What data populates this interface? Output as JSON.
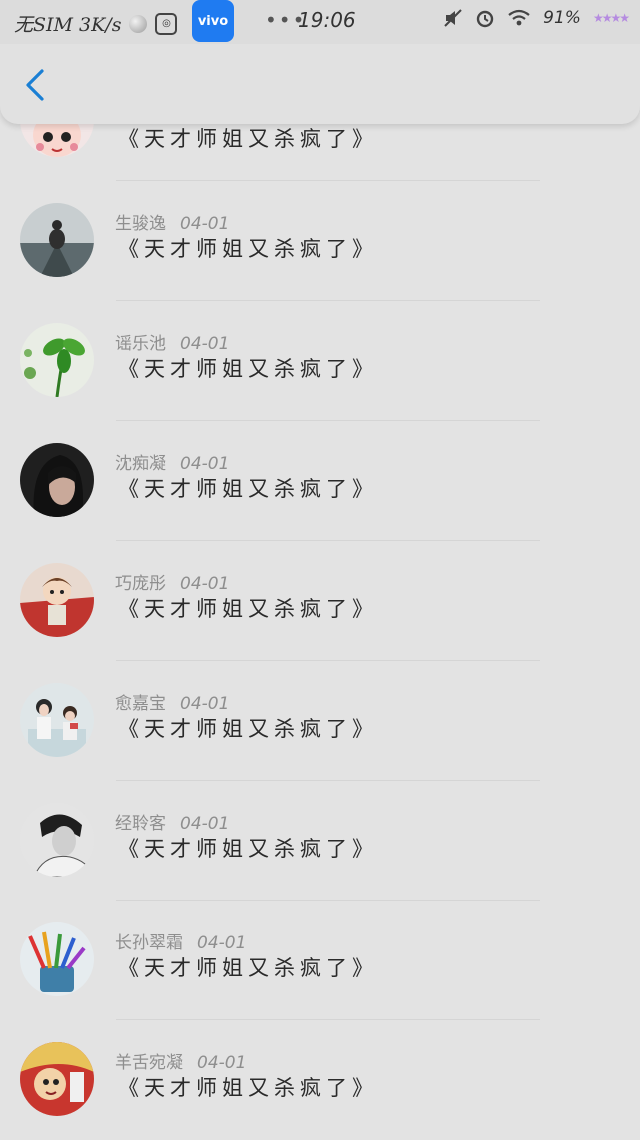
{
  "statusbar": {
    "carrier": "无SIM 3K/s",
    "vivo_badge": "vivo",
    "dots": "•••",
    "time": "19:06",
    "battery": "91%"
  },
  "nav": {
    "back_icon": "chevron-left-icon",
    "accent": "#1a7fd4"
  },
  "comments": [
    {
      "name": "",
      "date": "",
      "title": "《天才师姐又杀疯了》",
      "avatar_icon": "cartoon-girl-avatar"
    },
    {
      "name": "生骏逸",
      "date": "04-01",
      "title": "《天才师姐又杀疯了》",
      "avatar_icon": "boat-photo-avatar"
    },
    {
      "name": "谣乐池",
      "date": "04-01",
      "title": "《天才师姐又杀疯了》",
      "avatar_icon": "clover-photo-avatar"
    },
    {
      "name": "沈痴凝",
      "date": "04-01",
      "title": "《天才师姐又杀疯了》",
      "avatar_icon": "dark-portrait-avatar"
    },
    {
      "name": "巧庞彤",
      "date": "04-01",
      "title": "《天才师姐又杀疯了》",
      "avatar_icon": "cartoon-boy-avatar"
    },
    {
      "name": "愈嘉宝",
      "date": "04-01",
      "title": "《天才师姐又杀疯了》",
      "avatar_icon": "two-girls-avatar"
    },
    {
      "name": "经聆客",
      "date": "04-01",
      "title": "《天才师姐又杀疯了》",
      "avatar_icon": "bw-portrait-avatar"
    },
    {
      "name": "长孙翠霜",
      "date": "04-01",
      "title": "《天才师姐又杀疯了》",
      "avatar_icon": "pencils-avatar"
    },
    {
      "name": "羊舌宛凝",
      "date": "04-01",
      "title": "《天才师姐又杀疯了》",
      "avatar_icon": "cartoon-red-avatar"
    }
  ]
}
